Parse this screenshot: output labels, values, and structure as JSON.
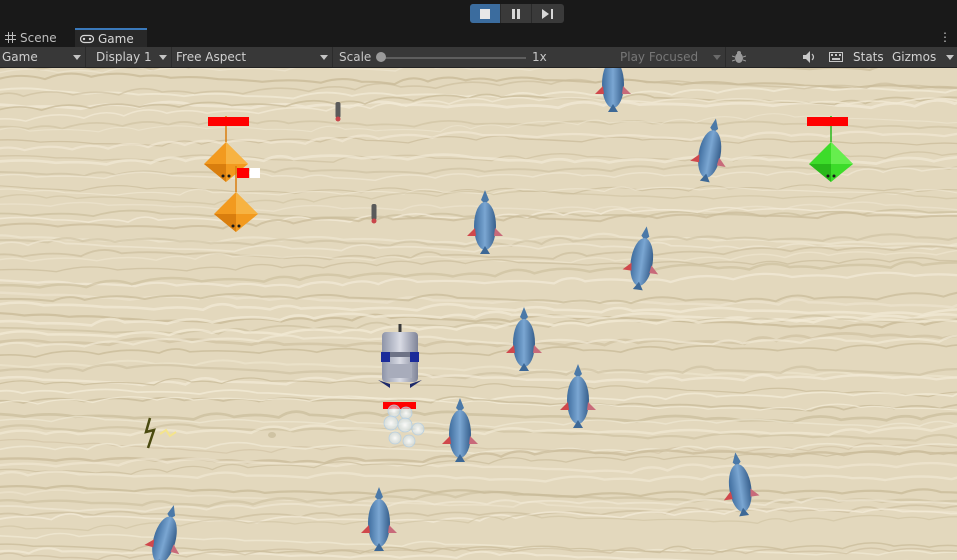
{
  "toolbar_tabs": [
    {
      "label": "Scene",
      "icon": "grid-icon"
    },
    {
      "label": "Game",
      "icon": "gamepad-icon"
    }
  ],
  "game_toolbar": {
    "view_mode": "Game",
    "display": "Display 1",
    "aspect": "Free Aspect",
    "scale_label": "Scale",
    "scale_value": "1x",
    "play_mode": "Play Focused",
    "stats_label": "Stats",
    "gizmos_label": "Gizmos"
  },
  "playbar": {
    "play_state": "playing",
    "buttons": [
      "stop-icon",
      "pause-icon",
      "step-icon"
    ]
  },
  "scene": {
    "background": "sand",
    "colors": {
      "sand": "#e3d8bd",
      "health_bar": "#ff0000",
      "enemy_orange": "#f29a1f",
      "enemy_green": "#3ddc2a",
      "fish_blue": "#5a87b8",
      "fin_red": "#d0484c"
    },
    "health_bars": 3
  }
}
